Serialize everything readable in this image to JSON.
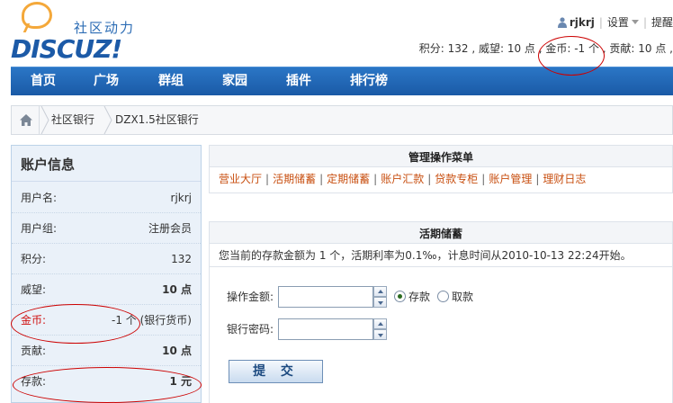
{
  "logo": {
    "cn": "社区动力",
    "en": "DISCUZ!"
  },
  "topbar": {
    "username": "rjkrj",
    "settings": "设置",
    "remind": "提醒"
  },
  "credits_line": "积分: 132 , 威望: 10 点 , 金币: -1 个 , 贡献: 10 点 ,",
  "nav": [
    "首页",
    "广场",
    "群组",
    "家园",
    "插件",
    "排行榜"
  ],
  "breadcrumb": [
    "社区银行",
    "DZX1.5社区银行"
  ],
  "account": {
    "title": "账户信息",
    "rows": [
      {
        "k": "用户名:",
        "v": "rjkrj"
      },
      {
        "k": "用户组:",
        "v": "注册会员"
      },
      {
        "k": "积分:",
        "v": "132"
      },
      {
        "k": "威望:",
        "v": "10 点"
      },
      {
        "k": "金币:",
        "v": "-1 个 (银行货币)"
      },
      {
        "k": "贡献:",
        "v": "10 点"
      },
      {
        "k": "存款:",
        "v": "1 元"
      }
    ]
  },
  "menu": {
    "title": "管理操作菜单",
    "links": [
      "营业大厅",
      "活期储蓄",
      "定期储蓄",
      "账户汇款",
      "贷款专柜",
      "账户管理",
      "理财日志"
    ]
  },
  "deposit": {
    "title": "活期储蓄",
    "info": "您当前的存款金额为 1 个，活期利率为0.1‰，计息时间从2010-10-13 22:24开始。",
    "amount_label": "操作金额:",
    "password_label": "银行密码:",
    "radio_deposit": "存款",
    "radio_withdraw": "取款",
    "submit": "提 交"
  },
  "colors": {
    "nav": "#1a5aa6",
    "link": "#c84f10",
    "annotation": "#cc0000"
  }
}
